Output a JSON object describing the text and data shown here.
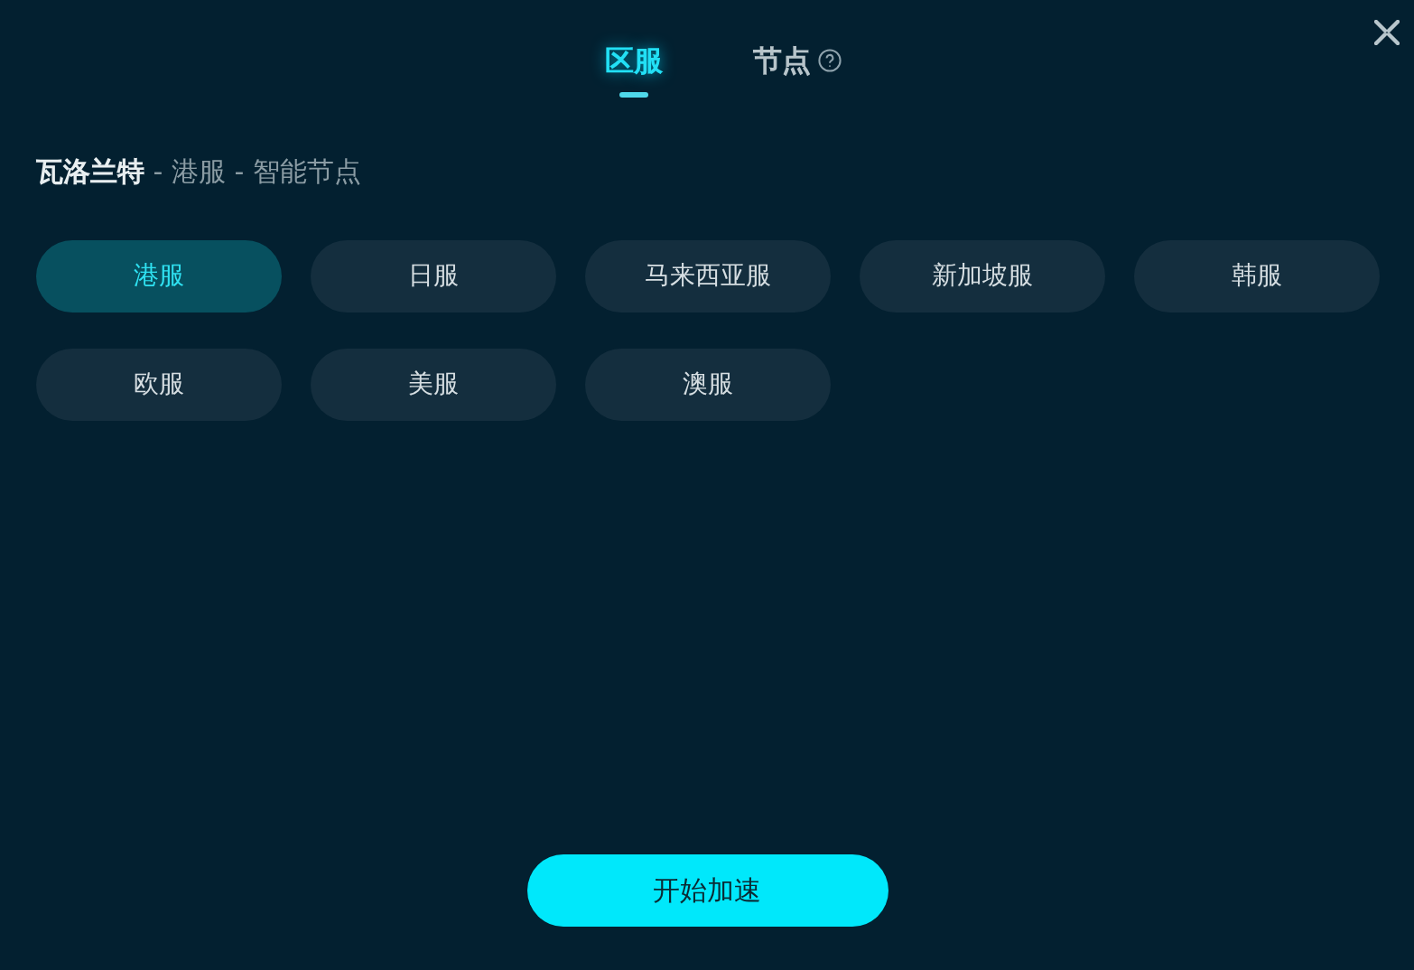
{
  "tabs": [
    {
      "label": "区服",
      "selected": true,
      "help": false
    },
    {
      "label": "节点",
      "selected": false,
      "help": true
    }
  ],
  "breadcrumb": "**瓦洛兰特** - 港服 - 智能节点",
  "servers": [
    {
      "label": "港服",
      "selected": true
    },
    {
      "label": "日服",
      "selected": false
    },
    {
      "label": "马来西亚服",
      "selected": false
    },
    {
      "label": "新加坡服",
      "selected": false
    },
    {
      "label": "韩服",
      "selected": false
    },
    {
      "label": "欧服",
      "selected": false
    },
    {
      "label": "美服",
      "selected": false
    },
    {
      "label": "澳服",
      "selected": false
    }
  ],
  "start_button": "开始加速"
}
